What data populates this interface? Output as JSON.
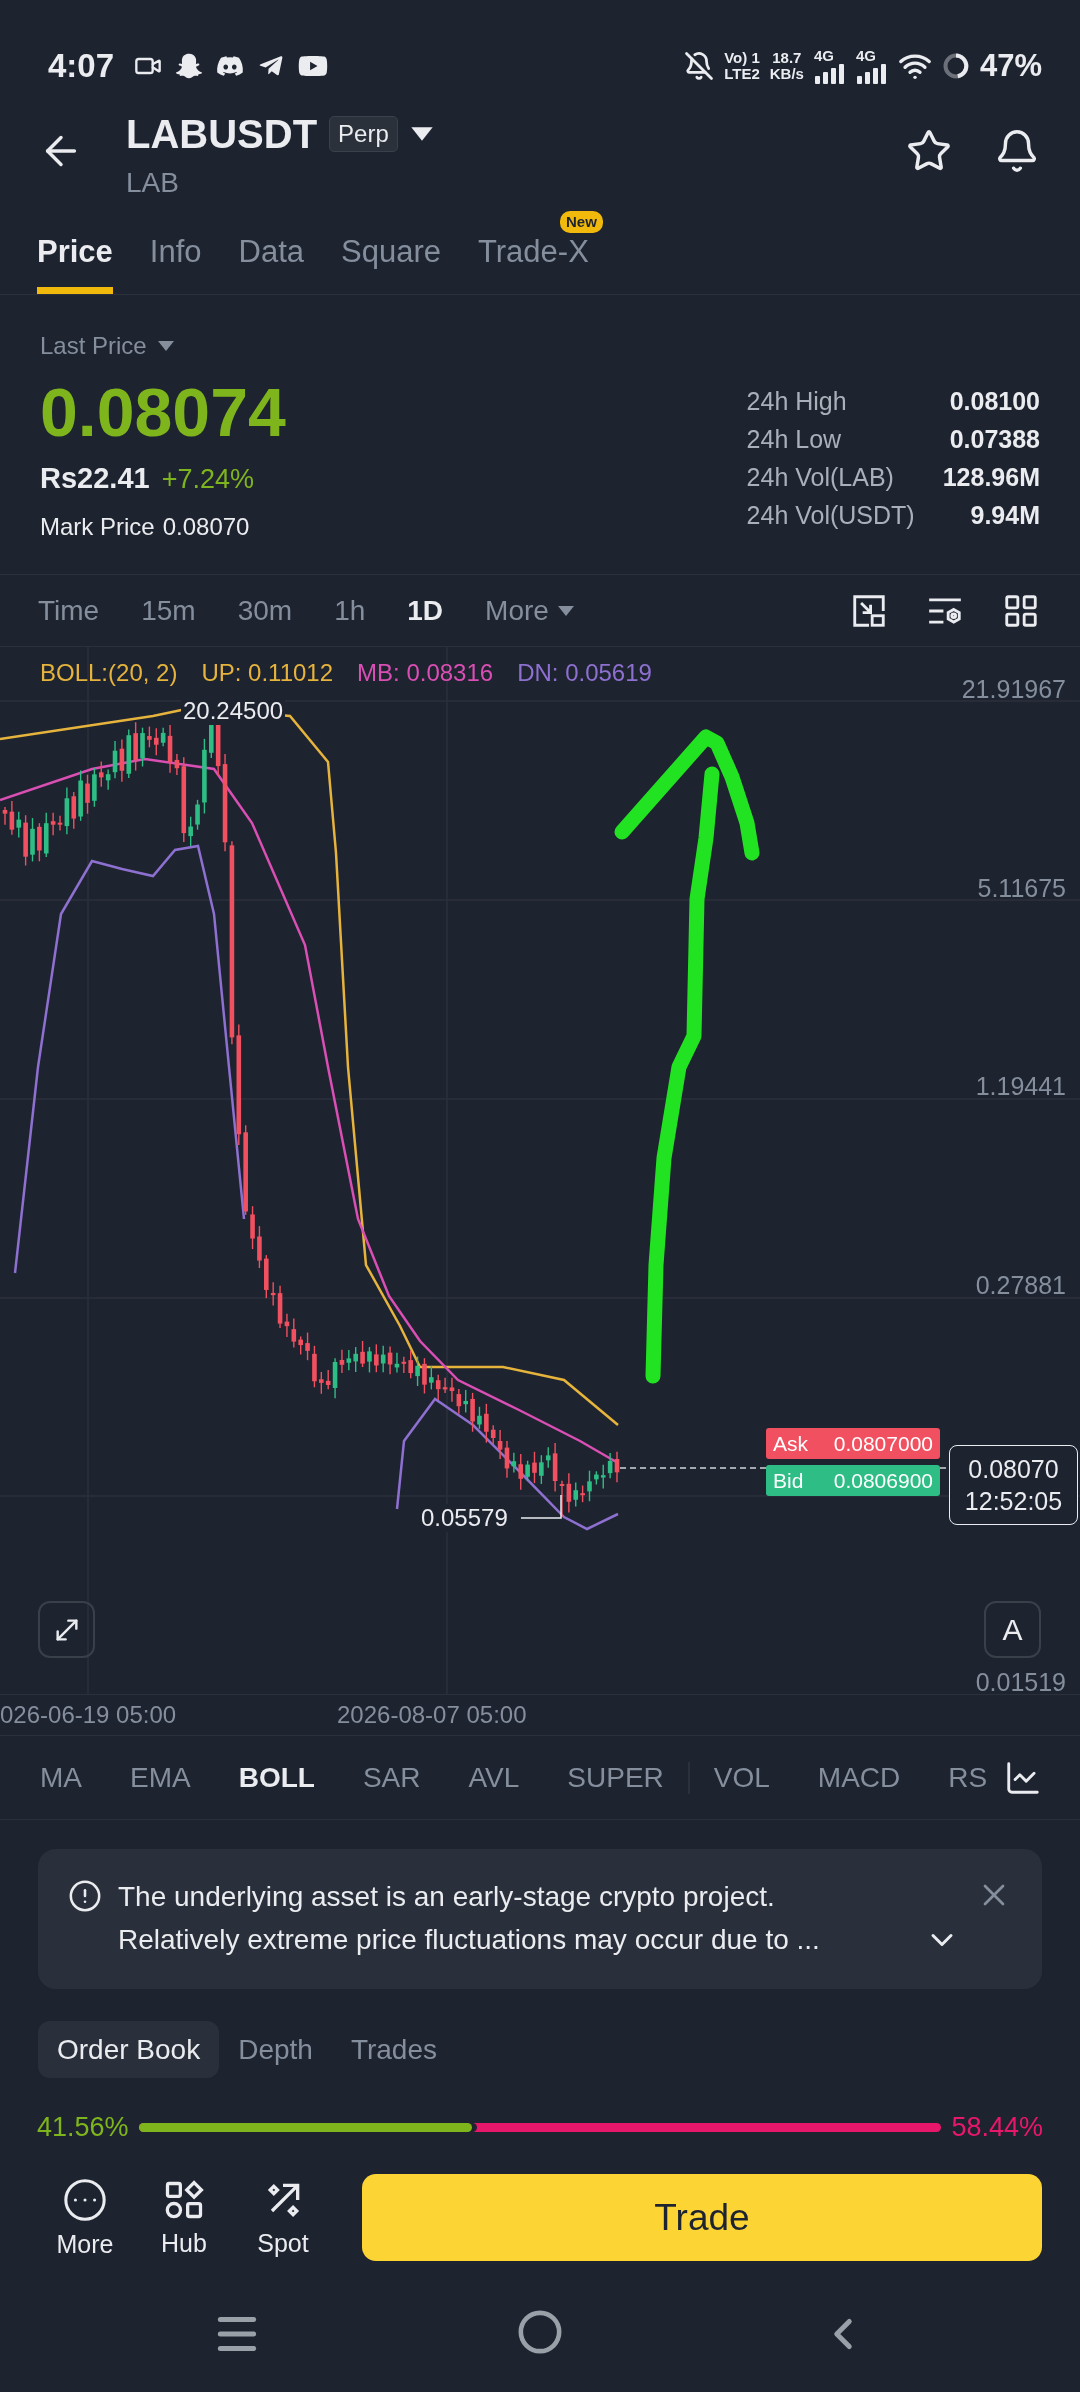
{
  "status_bar": {
    "time": "4:07",
    "volte": "Vo) 1",
    "volte_band": "LTE2",
    "speed": "18.7",
    "speed_unit": "KB/s",
    "networks": [
      "4G",
      "4G"
    ],
    "battery": "47%"
  },
  "header": {
    "symbol": "LABUSDT",
    "badge": "Perp",
    "subtitle": "LAB"
  },
  "tabs": [
    {
      "label": "Price",
      "selected": true
    },
    {
      "label": "Info",
      "selected": false
    },
    {
      "label": "Data",
      "selected": false
    },
    {
      "label": "Square",
      "selected": false
    },
    {
      "label": "Trade-X",
      "selected": false,
      "badge": "New"
    }
  ],
  "price": {
    "label": "Last Price",
    "value": "0.08074",
    "fiat": "Rs22.41",
    "change": "+7.24%",
    "mark_label": "Mark Price",
    "mark_value": "0.08070"
  },
  "stats": [
    {
      "label": "24h High",
      "value": "0.08100"
    },
    {
      "label": "24h Low",
      "value": "0.07388"
    },
    {
      "label": "24h Vol(LAB)",
      "value": "128.96M"
    },
    {
      "label": "24h Vol(USDT)",
      "value": "9.94M"
    }
  ],
  "intervals": [
    {
      "label": "Time",
      "selected": false,
      "kind": "interval"
    },
    {
      "label": "15m",
      "selected": false,
      "kind": "interval"
    },
    {
      "label": "30m",
      "selected": false,
      "kind": "interval"
    },
    {
      "label": "1h",
      "selected": false,
      "kind": "interval"
    },
    {
      "label": "1D",
      "selected": true,
      "kind": "interval"
    },
    {
      "label": "More",
      "selected": false,
      "kind": "menu"
    }
  ],
  "chart": {
    "legend": [
      {
        "text": "BOLL:(20, 2)",
        "color": "#e6b43c"
      },
      {
        "text": "UP: 0.11012",
        "color": "#e6b43c"
      },
      {
        "text": "MB: 0.08316",
        "color": "#d94fb4"
      },
      {
        "text": "DN: 0.05619",
        "color": "#8d70cf"
      }
    ],
    "y_labels": [
      "21.91967",
      "5.11675",
      "1.19441",
      "0.27881",
      "0.01519"
    ],
    "x_labels": [
      "026-06-19 05:00",
      "2026-08-07 05:00"
    ],
    "high_label": "20.24500",
    "low_label": "0.05579",
    "ask": {
      "label": "Ask",
      "value": "0.0807000"
    },
    "bid": {
      "label": "Bid",
      "value": "0.0806900"
    },
    "mark_price": "0.08070",
    "countdown": "12:52:05",
    "scale_button": "A"
  },
  "indicators": {
    "main": [
      {
        "label": "MA",
        "selected": false
      },
      {
        "label": "EMA",
        "selected": false
      },
      {
        "label": "BOLL",
        "selected": true
      },
      {
        "label": "SAR",
        "selected": false
      },
      {
        "label": "AVL",
        "selected": false
      },
      {
        "label": "SUPER",
        "selected": false
      }
    ],
    "sub": [
      {
        "label": "VOL",
        "selected": false
      },
      {
        "label": "MACD",
        "selected": false
      },
      {
        "label": "RS",
        "selected": false
      }
    ]
  },
  "notice": {
    "lines": [
      "The underlying asset is an early-stage crypto project.",
      "Relatively extreme price fluctuations may occur due to ..."
    ]
  },
  "book_tabs": [
    {
      "label": "Order Book",
      "selected": true
    },
    {
      "label": "Depth",
      "selected": false
    },
    {
      "label": "Trades",
      "selected": false
    }
  ],
  "ratio": {
    "buy": "41.56%",
    "sell": "58.44%",
    "level": 0.4156
  },
  "actions": [
    {
      "label": "More",
      "kind": "more"
    },
    {
      "label": "Hub",
      "kind": "hub"
    },
    {
      "label": "Spot",
      "kind": "spot"
    }
  ],
  "trade_button": "Trade"
}
